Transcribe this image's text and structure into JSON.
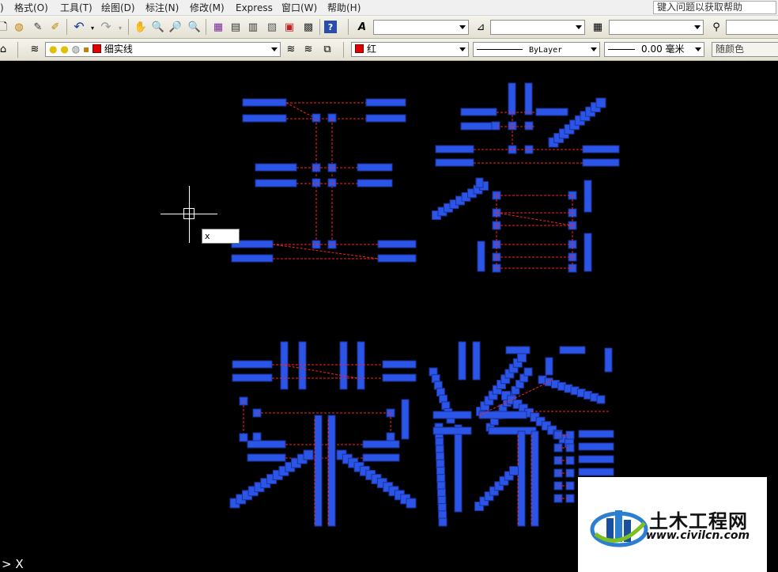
{
  "menu": {
    "items": [
      "格式(O)",
      "工具(T)",
      "绘图(D)",
      "标注(N)",
      "修改(M)",
      "Express",
      "窗口(W)",
      "帮助(H)"
    ],
    "help_search": "键入问题以获取帮助"
  },
  "toolbar_properties": {
    "layer_value": "细实线",
    "color_value": "红",
    "linetype_value": "ByLayer",
    "lineweight_value": "0.00 毫米",
    "plotstyle_value": "随颜色"
  },
  "drawing": {
    "dynamic_input_value": "x",
    "command_prompt": "X",
    "text_colors": {
      "fill": "#2a55e6",
      "fill_border": "#1a2f9a",
      "dashed": "#ff2020"
    },
    "crosshair_color": "#ffffff"
  },
  "watermark": {
    "name": "土木工程网",
    "url": "www.civilcn.com"
  },
  "colors": {
    "menubar": "#f0f0f0",
    "toolbar": "#ece9d8",
    "canvas": "#000000",
    "accent_red": "#e00000"
  }
}
